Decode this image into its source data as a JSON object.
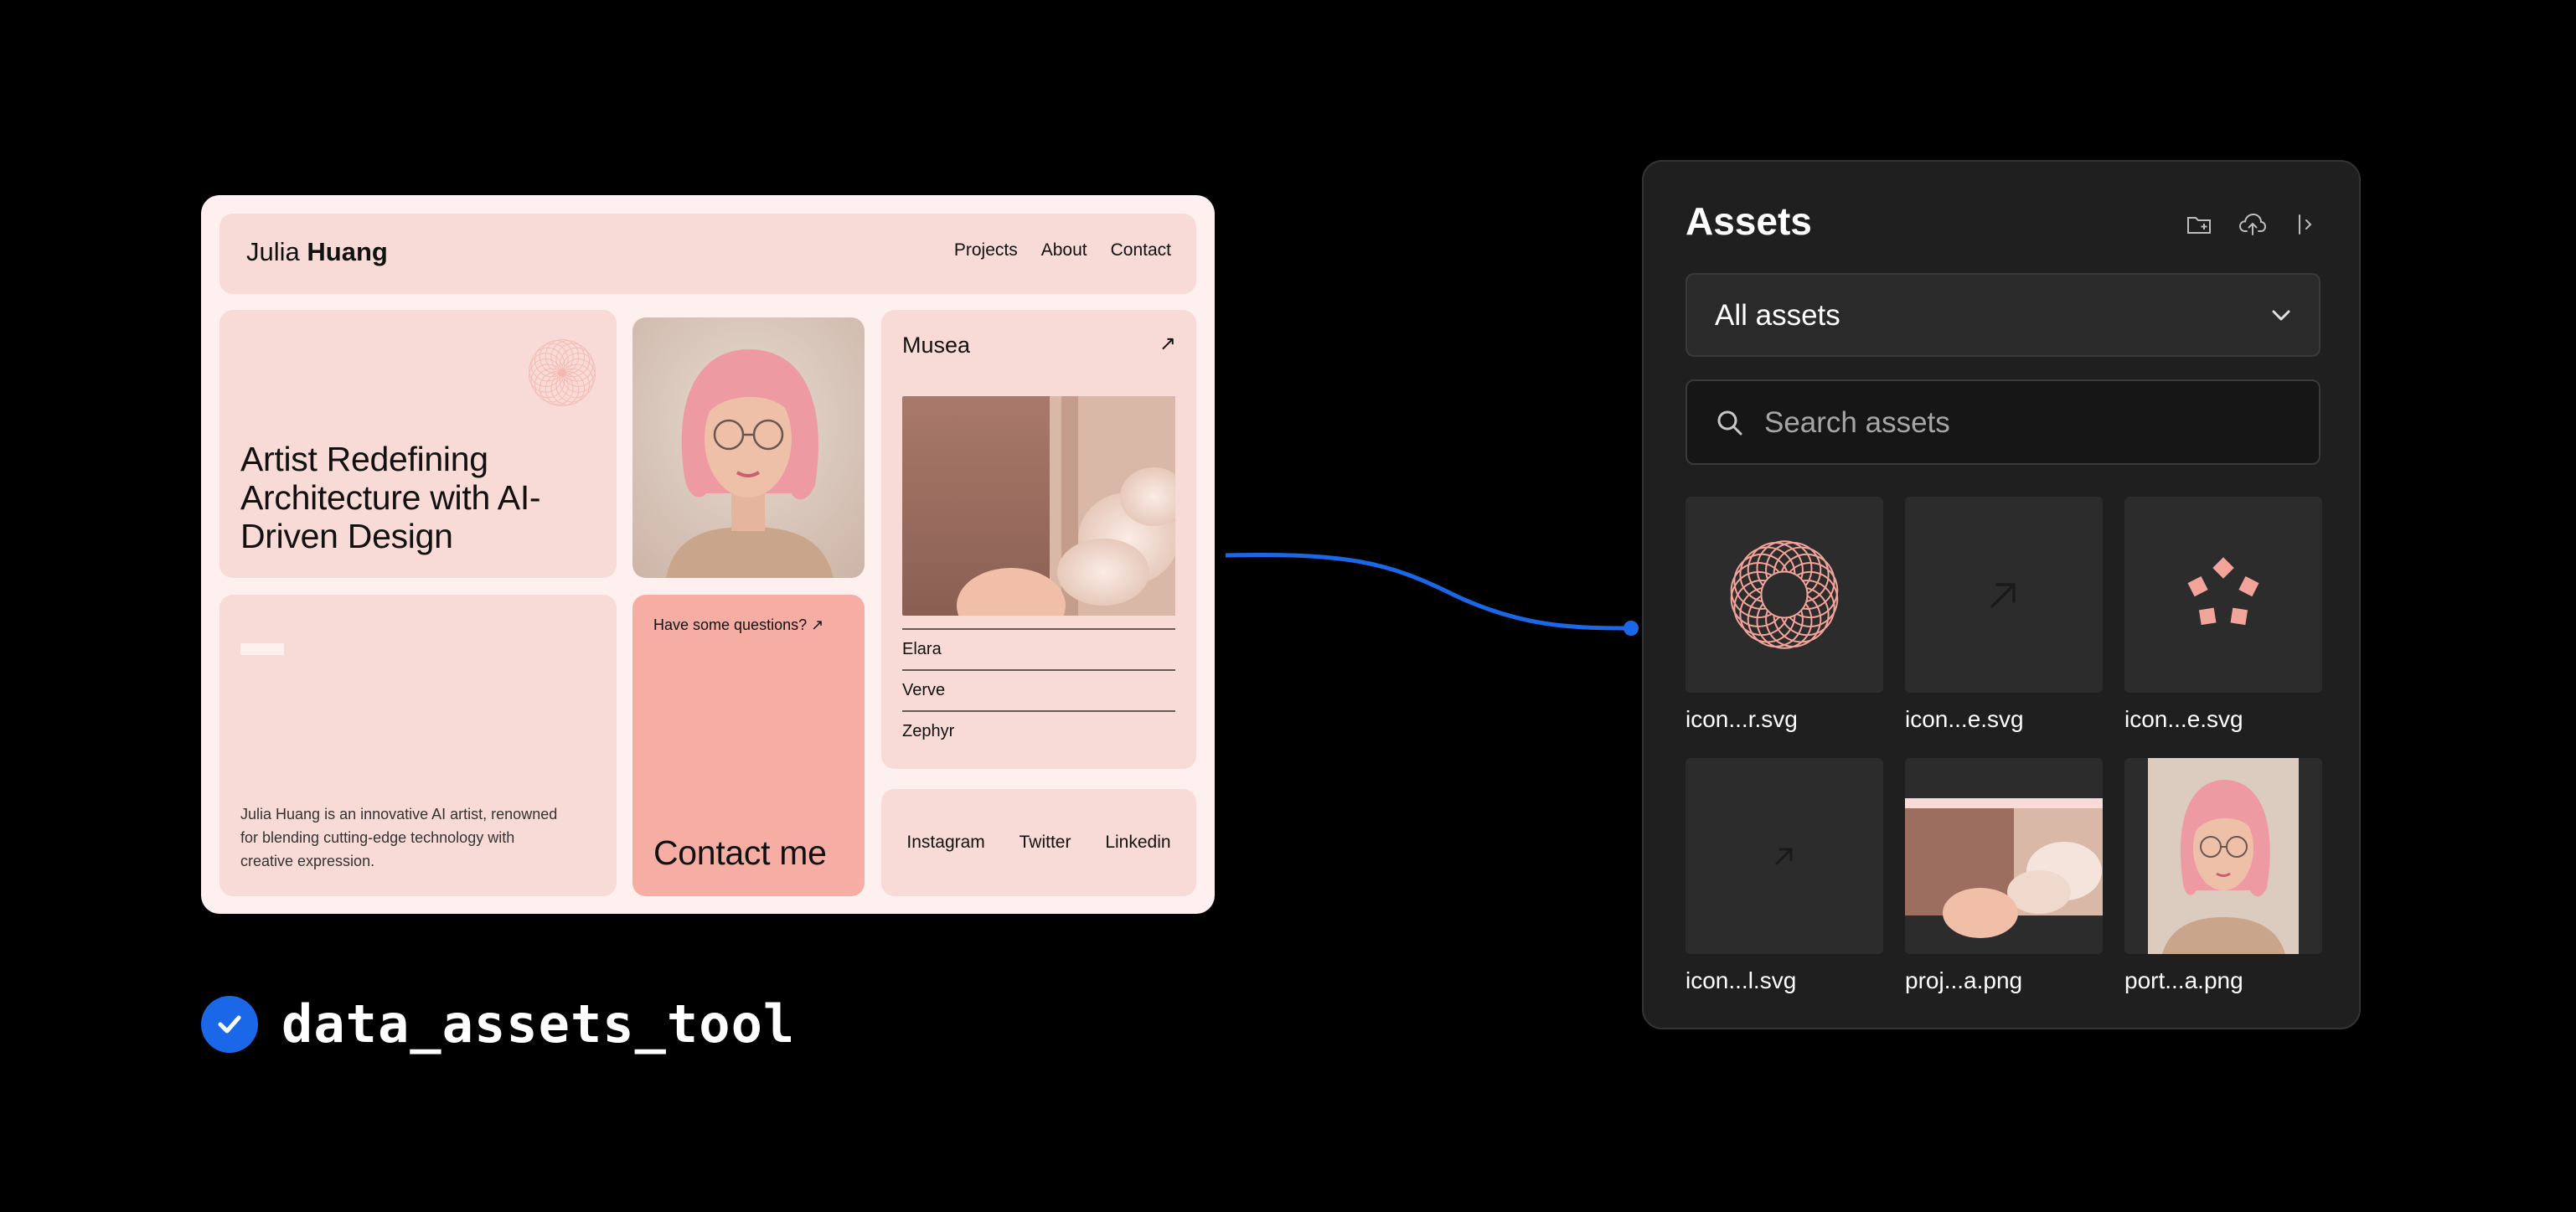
{
  "site": {
    "brand_first": "Julia",
    "brand_last": "Huang",
    "nav": [
      "Projects",
      "About",
      "Contact"
    ],
    "hero_title": "Artist Redefining Architecture with AI-Driven Design",
    "bio": "Julia Huang is an innovative AI artist, renowned for blending cutting-edge technology with creative expression.",
    "contact_question": "Have some questions? ↗",
    "contact_cta": "Contact me",
    "project_title": "Musea",
    "project_arrow": "↗",
    "project_list": [
      "Elara",
      "Verve",
      "Zephyr"
    ],
    "socials": [
      "Instagram",
      "Twitter",
      "Linkedin"
    ]
  },
  "tool": {
    "name": "data_assets_tool"
  },
  "assets_panel": {
    "title": "Assets",
    "actions": [
      "new-folder-icon",
      "upload-icon",
      "collapse-panel-icon"
    ],
    "filter_value": "All assets",
    "search_placeholder": "Search assets",
    "items": [
      {
        "label": "icon...r.svg",
        "kind": "rosette"
      },
      {
        "label": "icon...e.svg",
        "kind": "arrow"
      },
      {
        "label": "icon...e.svg",
        "kind": "star"
      },
      {
        "label": "icon...l.svg",
        "kind": "arrow-small"
      },
      {
        "label": "proj...a.png",
        "kind": "project-image"
      },
      {
        "label": "port...a.png",
        "kind": "portrait-image"
      }
    ]
  },
  "colors": {
    "accent": "#1a68e8",
    "blush": "#f8dad6",
    "salmon": "#f6ada4",
    "panel": "#1f1f1f"
  }
}
